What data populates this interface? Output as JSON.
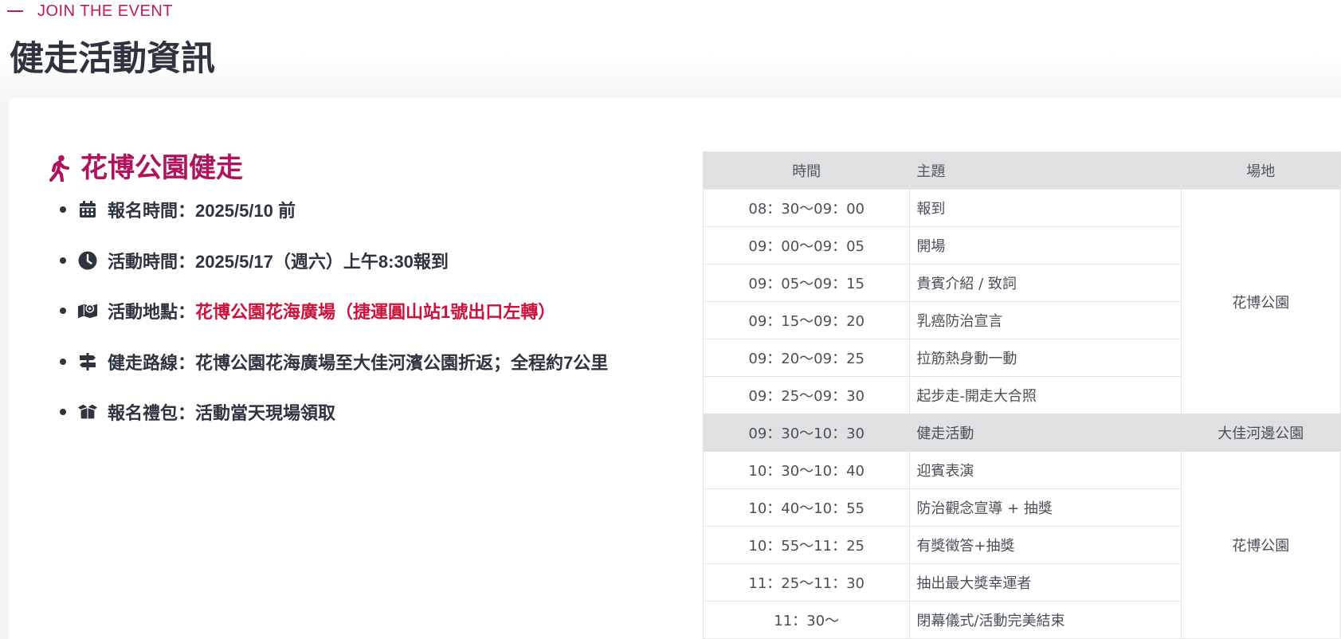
{
  "header": {
    "eyebrow": "JOIN THE EVENT",
    "title": "健走活動資訊"
  },
  "section": {
    "title": "花博公園健走",
    "icon": "walking-person-icon"
  },
  "info": [
    {
      "icon": "calendar-icon",
      "label": "報名時間：",
      "value": "2025/5/10 前",
      "highlight": false
    },
    {
      "icon": "clock-icon",
      "label": "活動時間：",
      "value": "2025/5/17（週六）上午8:30報到",
      "highlight": false
    },
    {
      "icon": "map-icon",
      "label": "活動地點：",
      "value": "花博公園花海廣場（捷運圓山站1號出口左轉）",
      "highlight": true
    },
    {
      "icon": "signpost-icon",
      "label": "健走路線：",
      "value": "花博公園花海廣場至大佳河濱公園折返；全程約7公里",
      "highlight": false
    },
    {
      "icon": "gift-box-icon",
      "label": "報名禮包：",
      "value": "活動當天現場領取",
      "highlight": false
    }
  ],
  "schedule": {
    "headers": [
      "時間",
      "主題",
      "場地"
    ],
    "rows": [
      {
        "time": "08：30～09：00",
        "topic": "報到"
      },
      {
        "time": "09：00～09：05",
        "topic": "開場"
      },
      {
        "time": "09：05～09：15",
        "topic": "貴賓介紹 / 致詞"
      },
      {
        "time": "09：15～09：20",
        "topic": "乳癌防治宣言"
      },
      {
        "time": "09：20～09：25",
        "topic": "拉筋熱身動一動"
      },
      {
        "time": "09：25～09：30",
        "topic": "起步走-開走大合照"
      },
      {
        "time": "09：30～10：30",
        "topic": "健走活動"
      },
      {
        "time": "10：30～10：40",
        "topic": "迎賓表演"
      },
      {
        "time": "10：40～10：55",
        "topic": "防治觀念宣導 + 抽獎"
      },
      {
        "time": "10：55～11：25",
        "topic": "有獎徵答+抽獎"
      },
      {
        "time": "11：25～11：30",
        "topic": "抽出最大獎幸運者"
      },
      {
        "time": "11：30～",
        "topic": "閉幕儀式/活動完美結束"
      }
    ],
    "venues": [
      "花博公園",
      "大佳河邊公園",
      "花博公園"
    ]
  },
  "colors": {
    "accent": "#c2185b",
    "highlight_red": "#d0103a",
    "text": "#2d3440",
    "table_header_bg": "#dfe0e2"
  }
}
